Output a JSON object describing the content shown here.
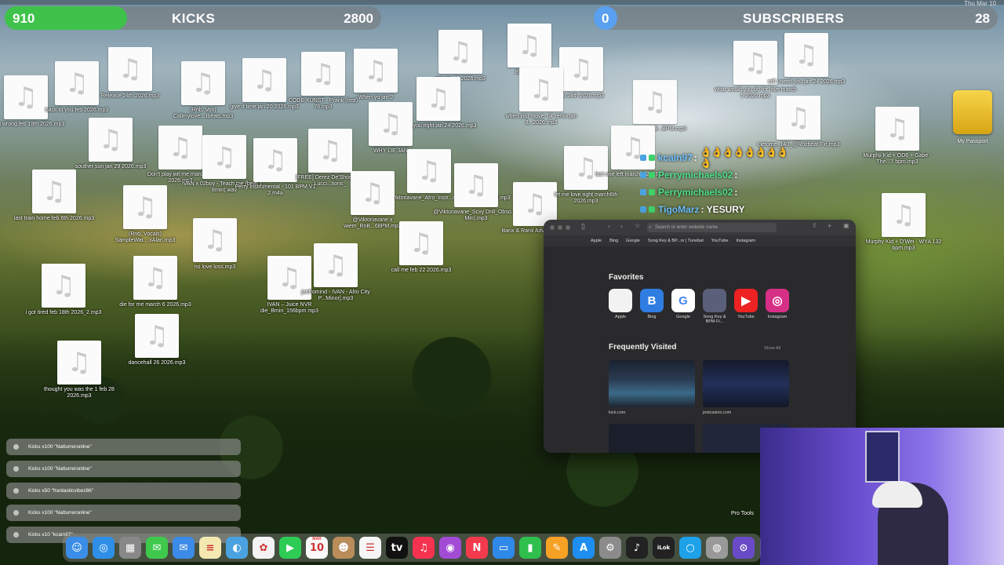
{
  "clock": "Thu Mar 10",
  "kicks_bar": {
    "current": "910",
    "label": "KICKS",
    "goal": "2800",
    "progress": 0.325,
    "color": "#3fc24a"
  },
  "subs_bar": {
    "current": "0",
    "label": "SUBSCRIBERS",
    "goal": "28",
    "progress": 0.0,
    "color": "#5aa0f0"
  },
  "desktop_files": [
    {
      "label": "going wrong feb 18th 2026.mp3"
    },
    {
      "label": "back to you feb 2026.mp3"
    },
    {
      "label": "Release 24th 2026.mp3"
    },
    {
      "label": "(Rnb, Vox) Callmylove....lbeats.mp3"
    },
    {
      "label": "give it time jan 20 2026.mp3"
    },
    {
      "label": "CODE KUNST - Prank (Inst) 76.mp3"
    },
    {
      "label": "When yo jan 2"
    },
    {
      "label": "me jan 18 2026.mp3"
    },
    {
      "label": "Bobby Safe"
    },
    {
      "label": "jan 24th 2026.mp3"
    },
    {
      "label": "what would you do for love march 5 2026.mp3"
    },
    {
      "label": "still i need you jan 24 2026.mp3"
    },
    {
      "label": "treat you right jan 24 2026.mp3"
    },
    {
      "label": "when you move- uk remix jan 3...2026.mp3"
    },
    {
      "label": "WHY LIE JAN"
    },
    {
      "label": "souther sun jan 29 2026.mp3"
    },
    {
      "label": "Don't play wit me march 10 2026.mp3"
    },
    {
      "label": "IVAN x 02boy - Teach me (beat 1... 8min).wav"
    },
    {
      "label": "Perry Instrumental - 101 BPM V1 2.m4a"
    },
    {
      "label": "[FREE] Derez De'Shon YFN Lucci...tions_"
    },
    {
      "label": "@Viktoriavane_Afro_Instr...ndm_Instr_95BPM.mp3"
    },
    {
      "label": "@Viktoriavane_Scxy Drill_Obso...# Min).mp3"
    },
    {
      "label": "last train home feb 6th 2026.mp3"
    },
    {
      "label": "(Rnb, Vocals) SampleWat....xAlan.mp3"
    },
    {
      "label": "@Viktoriavane x wiem_RnB...68PM.mp3"
    },
    {
      "label": "Banx & Ranx Advice - 105 i"
    },
    {
      "label": "let me love right march6th 2026.mp3"
    },
    {
      "label": "no love loss.mp3"
    },
    {
      "label": "call me feb 22 2026.mp3"
    },
    {
      "label": "i got tired feb 18th 2026_2.mp3"
    },
    {
      "label": "die for me march 6 2026.mp3"
    },
    {
      "label": "IVAN – Juice NVR die_Bmin_156bpm.mp3"
    },
    {
      "label": "janfromind - IVAN - Afro City P...Minor].mp3"
    },
    {
      "label": "dancehall 26 2026.mp3"
    },
    {
      "label": "thought you was the 1 feb 28 2026.mp3"
    },
    {
      "label": "Murphy Kid + OD6 + Gabe - The...7 bpm.mp3"
    },
    {
      "label": "Murphy Kid + D'Wei - WYA 132 bpm.mp3"
    },
    {
      "label": "Lietome_140_@Rozbeat Fxf.mp3"
    },
    {
      "label": "IVAN - m_168...BPM.mp3"
    },
    {
      "label": "last one left march 2 2026.mp3"
    }
  ],
  "drive": {
    "label": "My Passport"
  },
  "chat": [
    {
      "user": "kcain97",
      "message": ":",
      "emojis": "👌👌👌👌👌👌👌👌👌"
    },
    {
      "user": "Perrymichaels02",
      "message": ":",
      "emojis": ""
    },
    {
      "user": "Perrymichaels02",
      "message": ":",
      "emojis": ""
    },
    {
      "user": "TigoMarz",
      "message": ": YESURY",
      "emojis": ""
    }
  ],
  "safari": {
    "url_placeholder": "Search or enter website name",
    "bookmarks": [
      "Apple",
      "Bing",
      "Google",
      "Song Key & BP...or | Tunebat",
      "YouTube",
      "Instagram"
    ],
    "favorites_title": "Favorites",
    "favorites": [
      {
        "label": "Apple",
        "glyph": "",
        "bg": "#f2f2f2",
        "fg": "#111"
      },
      {
        "label": "Bing",
        "glyph": "B",
        "bg": "#2f7de1",
        "fg": "#fff"
      },
      {
        "label": "Google",
        "glyph": "G",
        "bg": "#ffffff",
        "fg": "#4285f4"
      },
      {
        "label": "Song Key & BPM Fi...",
        "glyph": "",
        "bg": "#5a5f7a",
        "fg": "#fff"
      },
      {
        "label": "YouTube",
        "glyph": "▶",
        "bg": "#e22",
        "fg": "#fff"
      },
      {
        "label": "Instagram",
        "glyph": "◎",
        "bg": "#d62f86",
        "fg": "#fff"
      }
    ],
    "frequent_title": "Frequently Visited",
    "show_all": "Show All",
    "frequent": [
      {
        "label": "kick.com"
      },
      {
        "label": "jestcasino.com"
      }
    ]
  },
  "notifications": [
    {
      "text": "Kicks x100 \"Natturreronline\""
    },
    {
      "text": "Kicks x100 \"Natturreronline\""
    },
    {
      "text": "Kicks x50 \"frantasticvibez86\""
    },
    {
      "text": "Kicks x100 \"Natturreronline\""
    },
    {
      "text": "Kicks x10 \"kcain97\""
    }
  ],
  "pro_tools_label": "Pro Tools",
  "dock": [
    {
      "name": "finder-icon",
      "glyph": "☺",
      "bg": "#3b8ee8"
    },
    {
      "name": "safari-icon",
      "glyph": "◎",
      "bg": "#2f8fe6"
    },
    {
      "name": "launchpad-icon",
      "glyph": "▦",
      "bg": "#888"
    },
    {
      "name": "messages-icon",
      "glyph": "✉",
      "bg": "#3ec94d"
    },
    {
      "name": "mail-icon",
      "glyph": "✉",
      "bg": "#3c8be8"
    },
    {
      "name": "notes-icon",
      "glyph": "≡",
      "bg": "#f3e8b0"
    },
    {
      "name": "preview-icon",
      "glyph": "◐",
      "bg": "#4aa3e0"
    },
    {
      "name": "photos-icon",
      "glyph": "✿",
      "bg": "#f3f3f3"
    },
    {
      "name": "facetime-icon",
      "glyph": "▶",
      "bg": "#2ecc55"
    },
    {
      "name": "calendar-icon",
      "glyph": "10",
      "bg": "#f8f8f8"
    },
    {
      "name": "contacts-icon",
      "glyph": "☻",
      "bg": "#b98c5a"
    },
    {
      "name": "reminders-icon",
      "glyph": "☰",
      "bg": "#f5f5f5"
    },
    {
      "name": "appletv-icon",
      "glyph": "tv",
      "bg": "#111"
    },
    {
      "name": "music-icon",
      "glyph": "♫",
      "bg": "#f5324f"
    },
    {
      "name": "podcasts-icon",
      "glyph": "◉",
      "bg": "#a24cd6"
    },
    {
      "name": "news-icon",
      "glyph": "N",
      "bg": "#f33a4c"
    },
    {
      "name": "keynote-icon",
      "glyph": "▭",
      "bg": "#2f89e8"
    },
    {
      "name": "numbers-icon",
      "glyph": "▮",
      "bg": "#2fbf4d"
    },
    {
      "name": "pages-icon",
      "glyph": "✎",
      "bg": "#f7a125"
    },
    {
      "name": "app-store-icon",
      "glyph": "A",
      "bg": "#1e8ef0"
    },
    {
      "name": "system-settings-icon",
      "glyph": "⚙",
      "bg": "#8b8b8b"
    },
    {
      "name": "logic-icon",
      "glyph": "♪",
      "bg": "#222"
    },
    {
      "name": "ilok-icon",
      "glyph": "iLok",
      "bg": "#222"
    },
    {
      "name": "circle-app-icon",
      "glyph": "○",
      "bg": "#1da1e8"
    },
    {
      "name": "disk-utility-icon",
      "glyph": "◍",
      "bg": "#999"
    },
    {
      "name": "obs-icon",
      "glyph": "⊙",
      "bg": "#6a4bc7"
    }
  ],
  "dock_calendar_month": "MAR"
}
